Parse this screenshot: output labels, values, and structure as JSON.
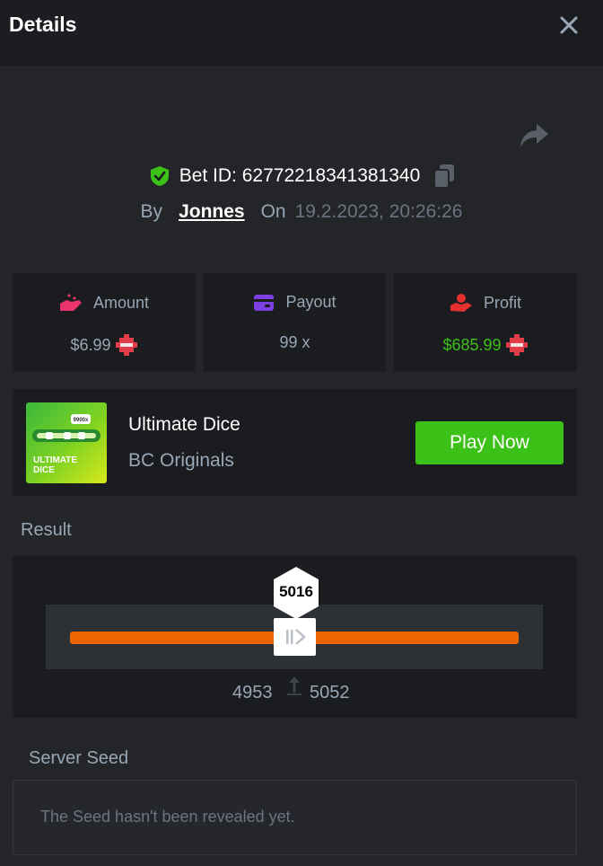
{
  "header": {
    "title": "Details"
  },
  "bet": {
    "id_text": "Bet ID: 62772218341381340",
    "by_label": "By",
    "user": "Jonnes",
    "on_label": "On",
    "datetime": "19.2.2023, 20:26:26"
  },
  "stats": [
    {
      "label": "Amount",
      "value": "$6.99",
      "icon": "amount-hand-icon",
      "color": "#e9346e"
    },
    {
      "label": "Payout",
      "value": "99 x",
      "icon": "wallet-card-icon",
      "color": "#7b3fe4"
    },
    {
      "label": "Profit",
      "value": "$685.99",
      "icon": "profit-hand-icon",
      "color": "#e63030"
    }
  ],
  "game": {
    "name": "Ultimate Dice",
    "provider": "BC Originals",
    "play_label": "Play Now",
    "thumb_title": "ULTIMATE DICE",
    "thumb_badge": "9900x"
  },
  "result": {
    "label": "Result",
    "value": "5016",
    "range_low": "4953",
    "range_high": "5052"
  },
  "seed": {
    "label": "Server Seed",
    "message": "The Seed hasn't been revealed yet."
  },
  "colors": {
    "accent_green": "#3bc117",
    "track_orange": "#ec6600",
    "coin_red": "#e03c4a"
  }
}
